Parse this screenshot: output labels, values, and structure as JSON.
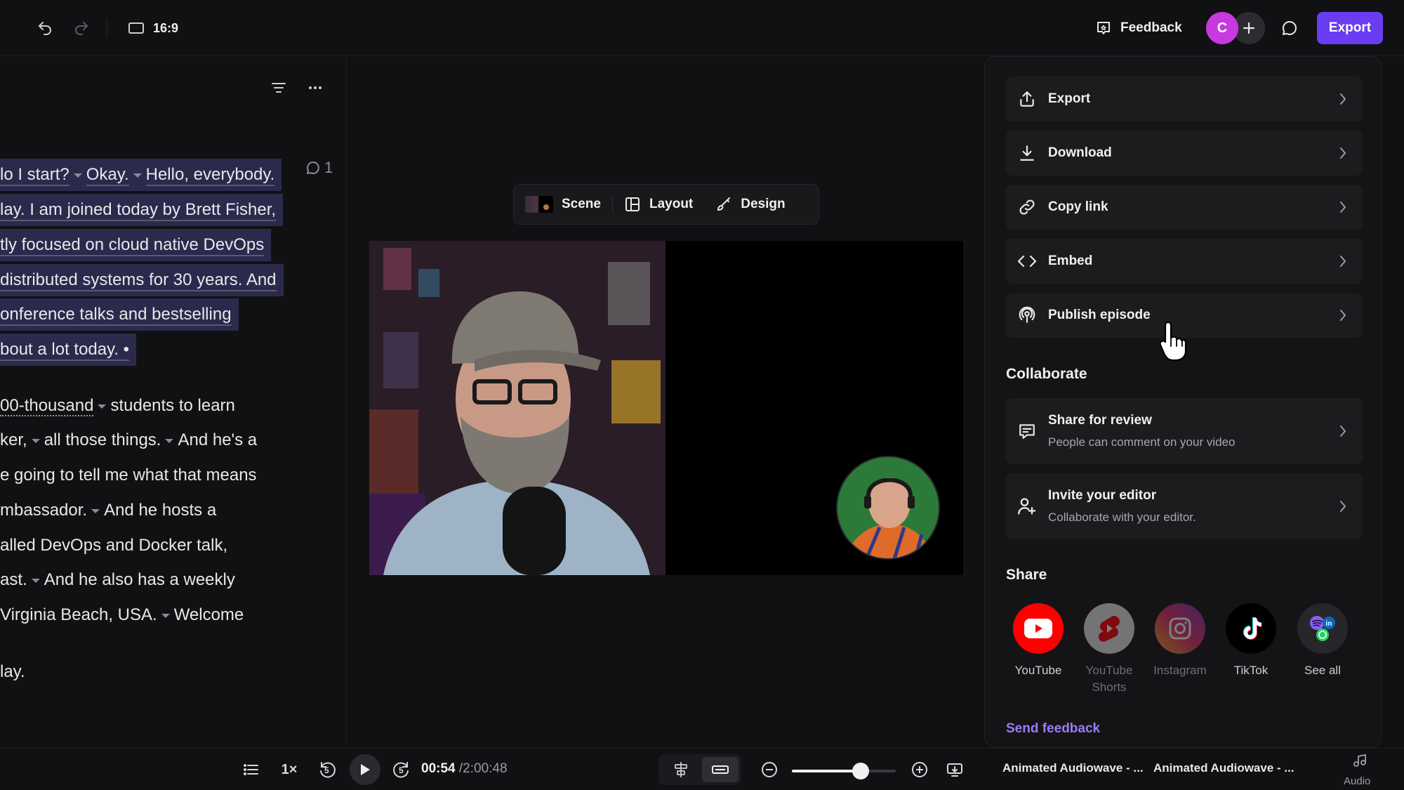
{
  "topbar": {
    "aspect_label": "16:9",
    "feedback_label": "Feedback",
    "avatar_initial": "C",
    "export_label": "Export"
  },
  "transcript": {
    "comment_count": "1",
    "lines": [
      {
        "segments": [
          {
            "t": "lo I start?"
          },
          {
            "tri": true
          },
          {
            "t": "Okay."
          },
          {
            "tri": true
          },
          {
            "t": "Hello, everybody."
          }
        ],
        "hl": true
      },
      {
        "segments": [
          {
            "t": "lay. I am joined today by Brett Fisher,"
          }
        ],
        "hl": true
      },
      {
        "segments": [
          {
            "t": "tly focused on cloud native DevOps"
          }
        ],
        "hl": true
      },
      {
        "segments": [
          {
            "t": "distributed systems for 30 years. And"
          }
        ],
        "hl": true
      },
      {
        "segments": [
          {
            "t": "onference talks and bestselling"
          }
        ],
        "hl": true
      },
      {
        "segments": [
          {
            "t": "bout a lot today. •"
          }
        ],
        "hl": true
      },
      {
        "segments": [
          {
            "t": "00-thousand",
            "dotted": true
          },
          {
            "tri": true
          },
          {
            "t": "students to learn"
          }
        ],
        "hl": false
      },
      {
        "segments": [
          {
            "t": "ker,"
          },
          {
            "tri": true
          },
          {
            "t": "all those things."
          },
          {
            "tri": true
          },
          {
            "t": "And he's a"
          }
        ],
        "hl": false
      },
      {
        "segments": [
          {
            "t": "e going to tell me what that means"
          }
        ],
        "hl": false
      },
      {
        "segments": [
          {
            "t": "mbassador."
          },
          {
            "tri": true
          },
          {
            "t": "And he hosts a"
          }
        ],
        "hl": false
      },
      {
        "segments": [
          {
            "t": "alled DevOps and Docker talk,"
          }
        ],
        "hl": false
      },
      {
        "segments": [
          {
            "t": "ast."
          },
          {
            "tri": true
          },
          {
            "t": "And he also has a weekly"
          }
        ],
        "hl": false
      },
      {
        "segments": [
          {
            "t": " Virginia Beach, USA."
          },
          {
            "tri": true
          },
          {
            "t": "Welcome"
          }
        ],
        "hl": false
      },
      {
        "segments": [
          {
            "t": "lay."
          }
        ],
        "hl": false
      }
    ]
  },
  "scene_bar": {
    "scene_label": "Scene",
    "layout_label": "Layout",
    "design_label": "Design"
  },
  "panel": {
    "menu": [
      {
        "id": "export",
        "label": "Export",
        "icon": "upload-icon"
      },
      {
        "id": "download",
        "label": "Download",
        "icon": "download-icon"
      },
      {
        "id": "copy-link",
        "label": "Copy link",
        "icon": "link-icon"
      },
      {
        "id": "embed",
        "label": "Embed",
        "icon": "code-icon"
      },
      {
        "id": "publish-episode",
        "label": "Publish episode",
        "icon": "podcast-icon"
      }
    ],
    "collaborate_title": "Collaborate",
    "collaborate": [
      {
        "id": "share-for-review",
        "label": "Share for review",
        "sub": "People can comment on your video",
        "icon": "comment-icon"
      },
      {
        "id": "invite-editor",
        "label": "Invite your editor",
        "sub": "Collaborate with your editor.",
        "icon": "add-user-icon"
      }
    ],
    "share_title": "Share",
    "share": [
      {
        "id": "youtube",
        "label": "YouTube",
        "color": "#ff0000",
        "enabled": true
      },
      {
        "id": "youtube-shorts",
        "label": "YouTube Shorts",
        "color": "#ff0000",
        "enabled": false
      },
      {
        "id": "instagram",
        "label": "Instagram",
        "color": "#c13584",
        "enabled": false
      },
      {
        "id": "tiktok",
        "label": "TikTok",
        "color": "#000000",
        "enabled": true
      },
      {
        "id": "see-all",
        "label": "See all",
        "color": "#2a2a2f",
        "enabled": true
      }
    ],
    "send_feedback_label": "Send feedback"
  },
  "bottombar": {
    "speed_label": "1×",
    "skip_back_label": "5",
    "current_time": "00:54",
    "total_time": "/2:00:48",
    "zoom_level": 0.66,
    "clips": [
      "Animated Audiowave - ...",
      "Animated Audiowave - ..."
    ],
    "audio_label": "Audio"
  },
  "colors": {
    "accent": "#6a3cf2",
    "avatar": "#c73adf",
    "highlight": "#2b2a4d",
    "link": "#9b7cf6"
  }
}
